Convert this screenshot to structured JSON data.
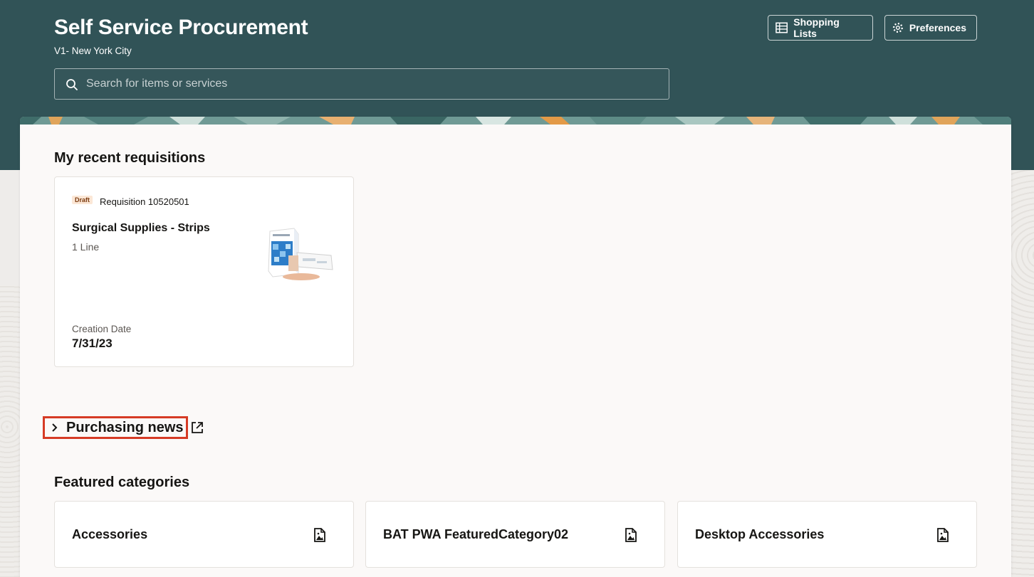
{
  "header": {
    "title": "Self Service Procurement",
    "subtitle": "V1- New York City",
    "search_placeholder": "Search for items or services",
    "buttons": {
      "shopping_lists": "Shopping Lists",
      "preferences": "Preferences"
    }
  },
  "recent": {
    "heading": "My recent requisitions",
    "card": {
      "status": "Draft",
      "number": "Requisition 10520501",
      "title": "Surgical Supplies - Strips",
      "lines": "1 Line",
      "date_label": "Creation Date",
      "date": "7/31/23"
    }
  },
  "news": {
    "label": "Purchasing news"
  },
  "featured": {
    "heading": "Featured categories",
    "categories": [
      {
        "name": "Accessories"
      },
      {
        "name": "BAT PWA FeaturedCategory02"
      },
      {
        "name": "Desktop Accessories"
      }
    ]
  },
  "colors": {
    "header_bg": "#315357",
    "panel_bg": "#fbf9f8",
    "highlight": "#d63b25",
    "draft_badge_bg": "#fbe7d6"
  },
  "icons": [
    "search-icon",
    "table-icon",
    "gear-icon",
    "chevron-right-icon",
    "external-link-icon",
    "image-file-icon"
  ]
}
